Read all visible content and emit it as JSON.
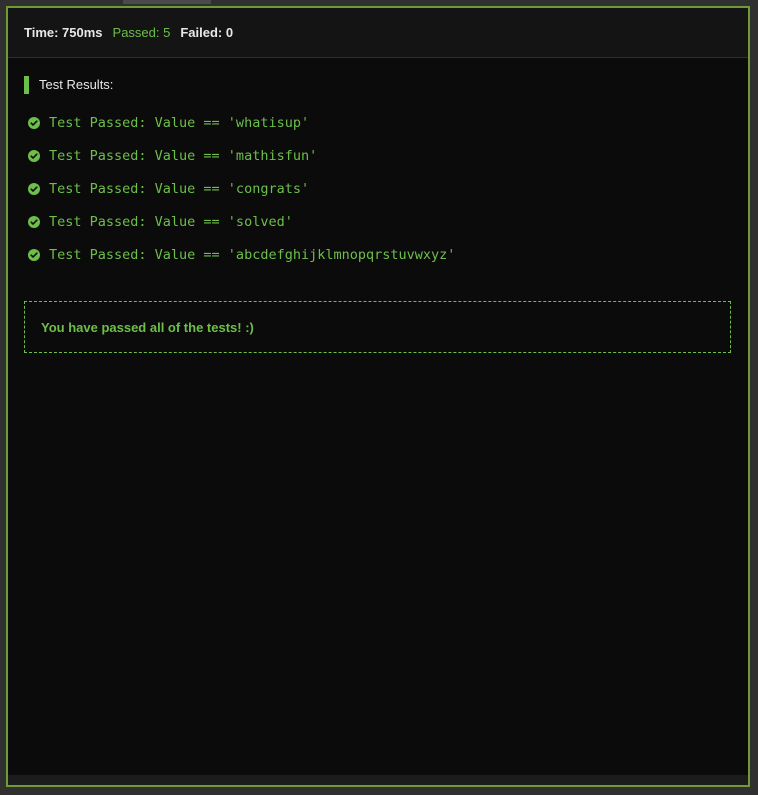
{
  "header": {
    "time": "Time: 750ms",
    "passed": "Passed: 5",
    "failed": "Failed: 0"
  },
  "results_title": "Test Results:",
  "results": [
    "Test Passed: Value == 'whatisup'",
    "Test Passed: Value == 'mathisfun'",
    "Test Passed: Value == 'congrats'",
    "Test Passed: Value == 'solved'",
    "Test Passed: Value == 'abcdefghijklmnopqrstuvwxyz'"
  ],
  "result_icon": "check-circle-icon",
  "success_message": "You have passed all of the tests! :)",
  "colors": {
    "accent": "#6dbf4a",
    "border": "#6f9a35",
    "background": "#0b0b0b"
  }
}
